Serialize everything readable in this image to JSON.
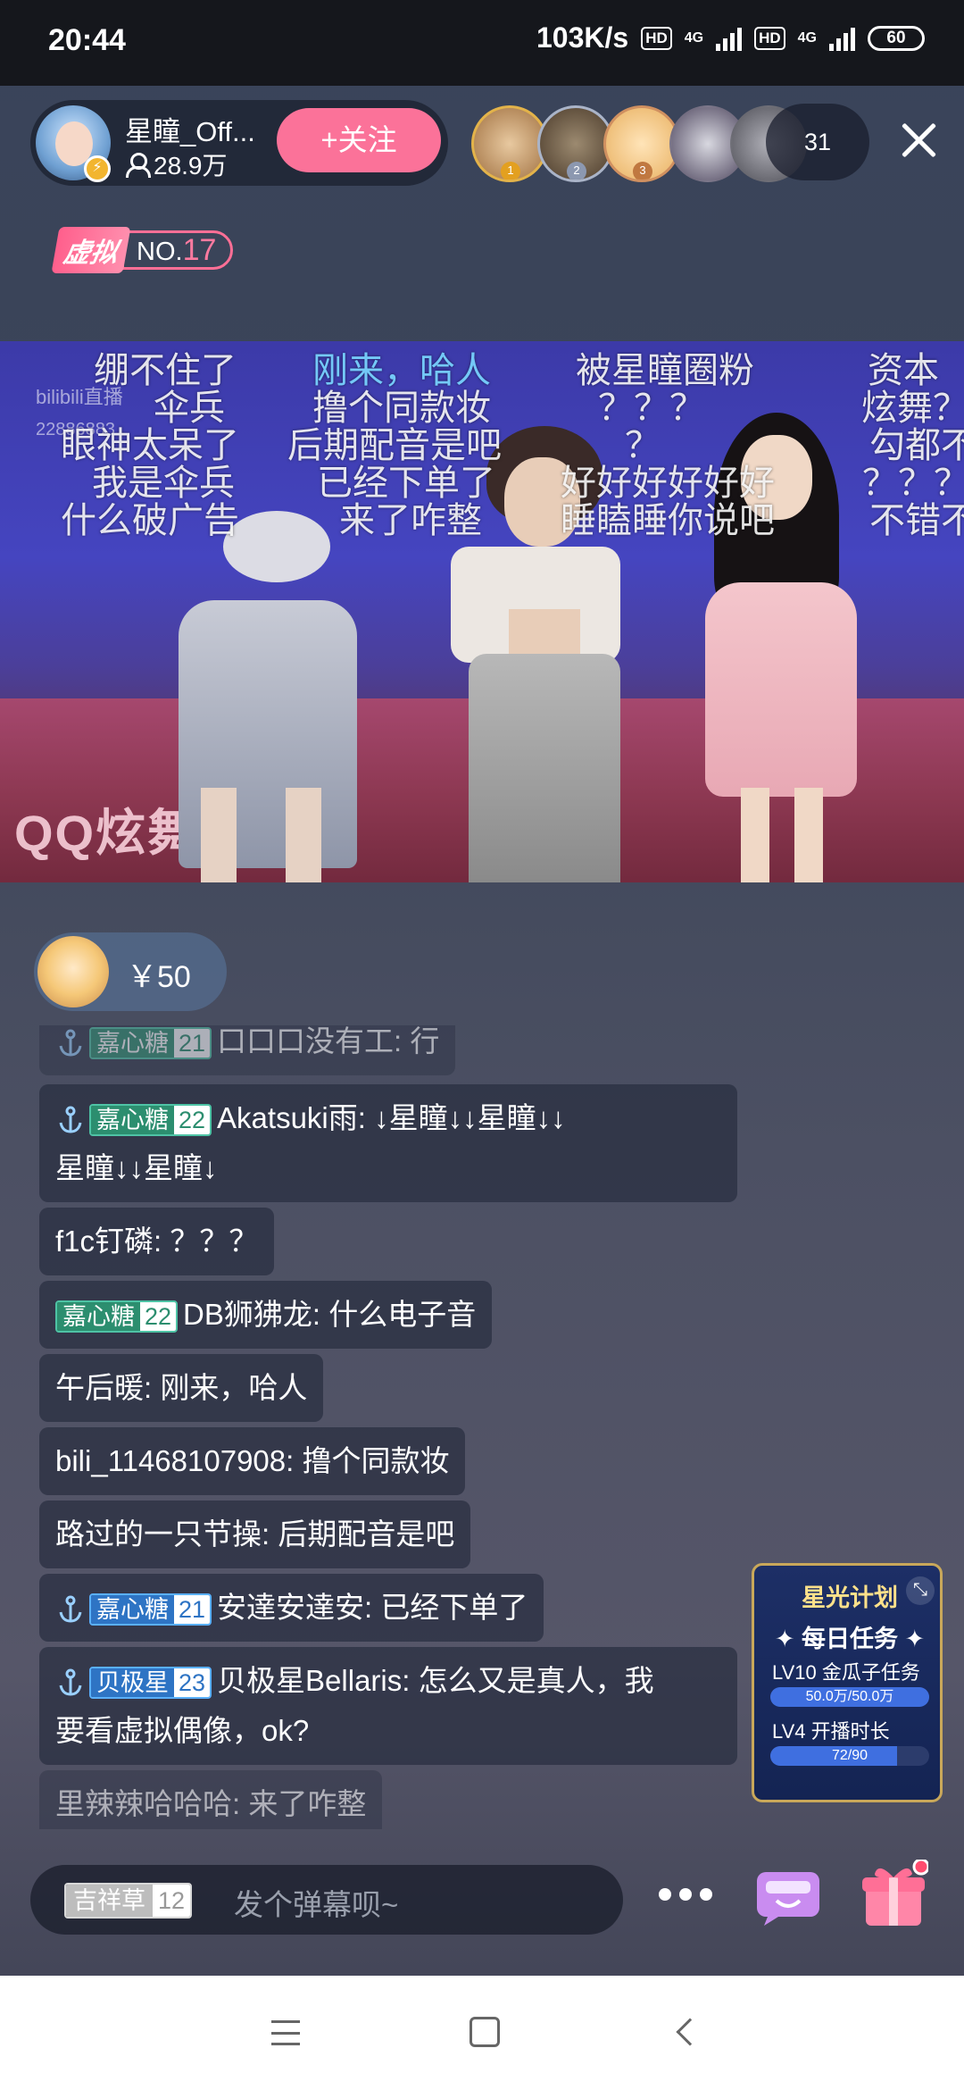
{
  "status_bar": {
    "time": "20:44",
    "network_speed": "103K/s",
    "hd_label": "HD",
    "network_type": "4G",
    "battery": "60"
  },
  "header": {
    "streamer_name": "星瞳_Off...",
    "followers": "28.9万",
    "follow_label": "+关注",
    "viewer_count": "31",
    "viewer_ranks": [
      "1",
      "2",
      "3"
    ]
  },
  "rank_badge": {
    "category": "虚拟",
    "prefix": "NO.",
    "number": "17"
  },
  "video": {
    "watermark": "bilibili直播",
    "room_id": "22886883",
    "stage_logo": "QQ炫舞",
    "danmaku": [
      [
        "绷不住了",
        "刚来，哈人",
        "被星瞳圈粉",
        "资本"
      ],
      [
        "伞兵",
        "撸个同款妆",
        "？？？",
        "炫舞？"
      ],
      [
        "眼神太呆了",
        "后期配音是吧",
        "？",
        "勾都不"
      ],
      [
        "我是伞兵",
        "已经下单了",
        "好好好好好好",
        "？？？"
      ],
      [
        "什么破广告",
        "来了咋整",
        "睡瞌睡你说吧",
        "不错不"
      ]
    ]
  },
  "gift": {
    "amount": "￥50"
  },
  "chat": [
    {
      "medal": "嘉心糖",
      "level": "21",
      "text": "口口口没有工: 行"
    },
    {
      "medal": "嘉心糖",
      "level": "22",
      "text": "Akatsuki雨: ↓星瞳↓↓星瞳↓↓",
      "text2": "星瞳↓↓星瞳↓"
    },
    {
      "text": "f1c钉磷: ？？？"
    },
    {
      "medal": "嘉心糖",
      "level": "22",
      "text": "DB狮狒龙: 什么电子音"
    },
    {
      "text": "午后暖: 刚来，哈人"
    },
    {
      "text": "bili_11468107908: 撸个同款妆"
    },
    {
      "text": "路过的一只节操: 后期配音是吧"
    },
    {
      "medal": "嘉心糖",
      "level": "21",
      "text": "安達安達安: 已经下单了"
    },
    {
      "medal": "贝极星",
      "level": "23",
      "text": "贝极星Bellaris: 怎么又是真人，我",
      "text2": "要看虚拟偶像，ok?"
    },
    {
      "text": "里辣辣哈哈哈: 来了咋整"
    }
  ],
  "star_plan": {
    "title": "星光计划",
    "task_title": "每日任务",
    "task1_label": "LV10 金瓜子任务",
    "task1_progress": "50.0万/50.0万",
    "task1_fraction": 1.0,
    "task2_label": "LV4 开播时长",
    "task2_progress": "72/90",
    "task2_fraction": 0.8
  },
  "input_bar": {
    "medal_name": "吉祥草",
    "medal_level": "12",
    "placeholder": "发个弹幕呗~"
  },
  "colors": {
    "accent_pink": "#fb7299",
    "medal_green": "#2c8e6f",
    "medal_blue": "#2e74c4",
    "gold": "#c9a85a"
  }
}
